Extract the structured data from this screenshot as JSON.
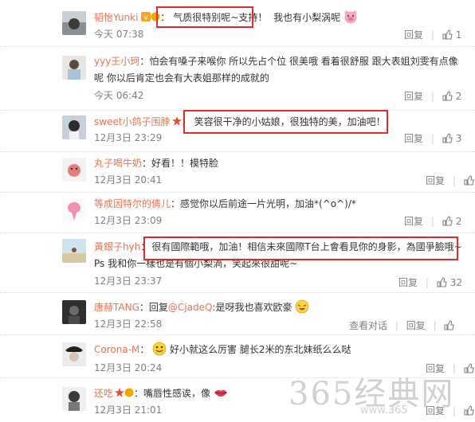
{
  "comments": [
    {
      "name": "韬怡Yunki",
      "text": "气质很特别呢~支持！",
      "text2": " 我也有小梨涡呢",
      "time": "今天 07:38",
      "reply": "回复",
      "likes": "1"
    },
    {
      "name": "yyy王小珂",
      "text": "：怕会有嗓子来喉你  所以先占个位 很美哦 看着很舒服 跟大表姐刘雯有点像",
      "text_cont": "呢 你以后肯定也会有大表姐那样的成就的",
      "time": "今天 06:42",
      "reply": "回复",
      "likes": "2"
    },
    {
      "name": "sweet小鸽子围脖",
      "text": "笑容很干净的小姑娘，很独特的美，加油吧！",
      "time": "12月3日 23:29",
      "reply": "回复",
      "likes": "3"
    },
    {
      "name": "丸子喝牛奶",
      "text": "：好看！！模特脸",
      "time": "12月3日 20:41",
      "reply": "回复",
      "likes": ""
    },
    {
      "name": "等成因特尔的倩儿",
      "text": "：感觉你以后前途一片光明，加油*(^o^)/*",
      "time": "12月3日 23:09",
      "reply": "回复",
      "likes": "2"
    },
    {
      "name": "黃銀子hyh",
      "text": "很有國際範哦，加油！相信未來國際T台上會看見你的身影，為國爭臉哦~",
      "text_cont": "Ps 我和你一樣也是有個小梨渦，笑起來很甜呢~",
      "time": "12月3日 23:37",
      "reply": "回复",
      "likes": "32"
    },
    {
      "name": "唐赫TANG",
      "text": "：回复",
      "mention": "@CjadeQ",
      "text_end": ":是呀我也喜欢欧豪",
      "time": "12月3日 22:58",
      "view": "查看对话",
      "reply": "回复",
      "likes": ""
    },
    {
      "name": "Corona-M",
      "text": "好小就这么厉害 腿长2米的东北妹纸么么哒",
      "time": "12月3日 20:24",
      "reply": "回复",
      "likes": ""
    },
    {
      "name": "还吃",
      "text": "：嘴唇性感诶，像",
      "time": "12月3日 21:01",
      "reply": "回复",
      "likes": ""
    }
  ],
  "watermark": "365经典网",
  "watermark_url": "www.365"
}
